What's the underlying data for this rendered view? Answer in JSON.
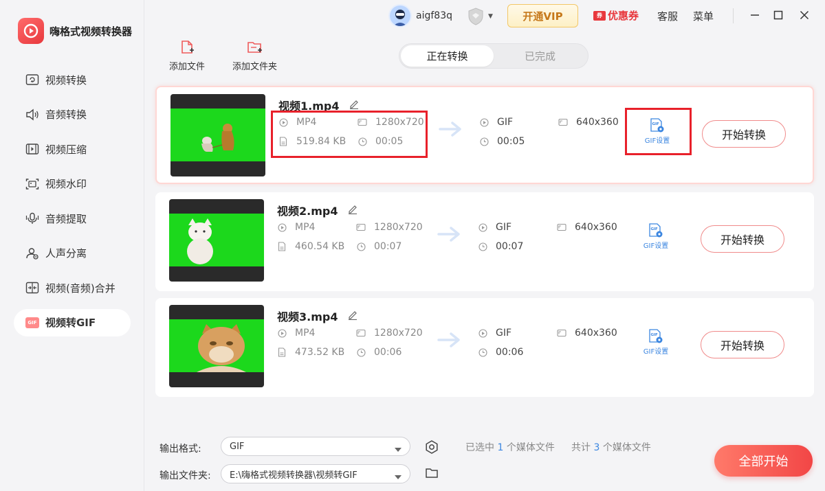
{
  "app": {
    "title": "嗨格式视频转换器"
  },
  "sidebar": {
    "items": [
      {
        "label": "视频转换",
        "icon": "video-convert-icon"
      },
      {
        "label": "音频转换",
        "icon": "audio-convert-icon"
      },
      {
        "label": "视频压缩",
        "icon": "video-compress-icon"
      },
      {
        "label": "视频水印",
        "icon": "video-watermark-icon"
      },
      {
        "label": "音频提取",
        "icon": "audio-extract-icon"
      },
      {
        "label": "人声分离",
        "icon": "vocal-separate-icon"
      },
      {
        "label": "视频(音频)合并",
        "icon": "merge-icon"
      },
      {
        "label": "视频转GIF",
        "icon": "gif-icon",
        "chip": "GIF",
        "active": true
      }
    ]
  },
  "header": {
    "username": "aigf83q",
    "vip_label": "开通VIP",
    "coupon_label": "优惠券",
    "coupon_tag": "券",
    "service_label": "客服",
    "menu_label": "菜单"
  },
  "toolbar": {
    "add_file_label": "添加文件",
    "add_folder_label": "添加文件夹"
  },
  "tabs": {
    "converting": "正在转换",
    "completed": "已完成"
  },
  "files": [
    {
      "name": "视频1.mp4",
      "src_format": "MP4",
      "src_resolution": "1280x720",
      "src_size": "519.84 KB",
      "src_duration": "00:05",
      "out_format": "GIF",
      "out_resolution": "640x360",
      "out_duration": "00:05",
      "gif_settings_label": "GIF设置",
      "gif_chip": "GIF",
      "start_label": "开始转换",
      "selected": true
    },
    {
      "name": "视频2.mp4",
      "src_format": "MP4",
      "src_resolution": "1280x720",
      "src_size": "460.54 KB",
      "src_duration": "00:07",
      "out_format": "GIF",
      "out_resolution": "640x360",
      "out_duration": "00:07",
      "gif_settings_label": "GIF设置",
      "gif_chip": "GIF",
      "start_label": "开始转换",
      "selected": false
    },
    {
      "name": "视频3.mp4",
      "src_format": "MP4",
      "src_resolution": "1280x720",
      "src_size": "473.52 KB",
      "src_duration": "00:06",
      "out_format": "GIF",
      "out_resolution": "640x360",
      "out_duration": "00:06",
      "gif_settings_label": "GIF设置",
      "gif_chip": "GIF",
      "start_label": "开始转换",
      "selected": false
    }
  ],
  "bottom": {
    "output_format_label": "输出格式:",
    "output_format_value": "GIF",
    "output_folder_label": "输出文件夹:",
    "output_folder_value": "E:\\嗨格式视频转换器\\视频转GIF",
    "selected_prefix": "已选中",
    "selected_count": "1",
    "selected_suffix": "个媒体文件",
    "total_prefix": "共计",
    "total_count": "3",
    "total_suffix": "个媒体文件",
    "start_all_label": "全部开始"
  },
  "colors": {
    "accent": "#e8383d",
    "link_blue": "#3b86e0",
    "highlight_red": "#e8202a",
    "vip_gold": "#c6781a",
    "green_screen": "#1cd81c"
  }
}
